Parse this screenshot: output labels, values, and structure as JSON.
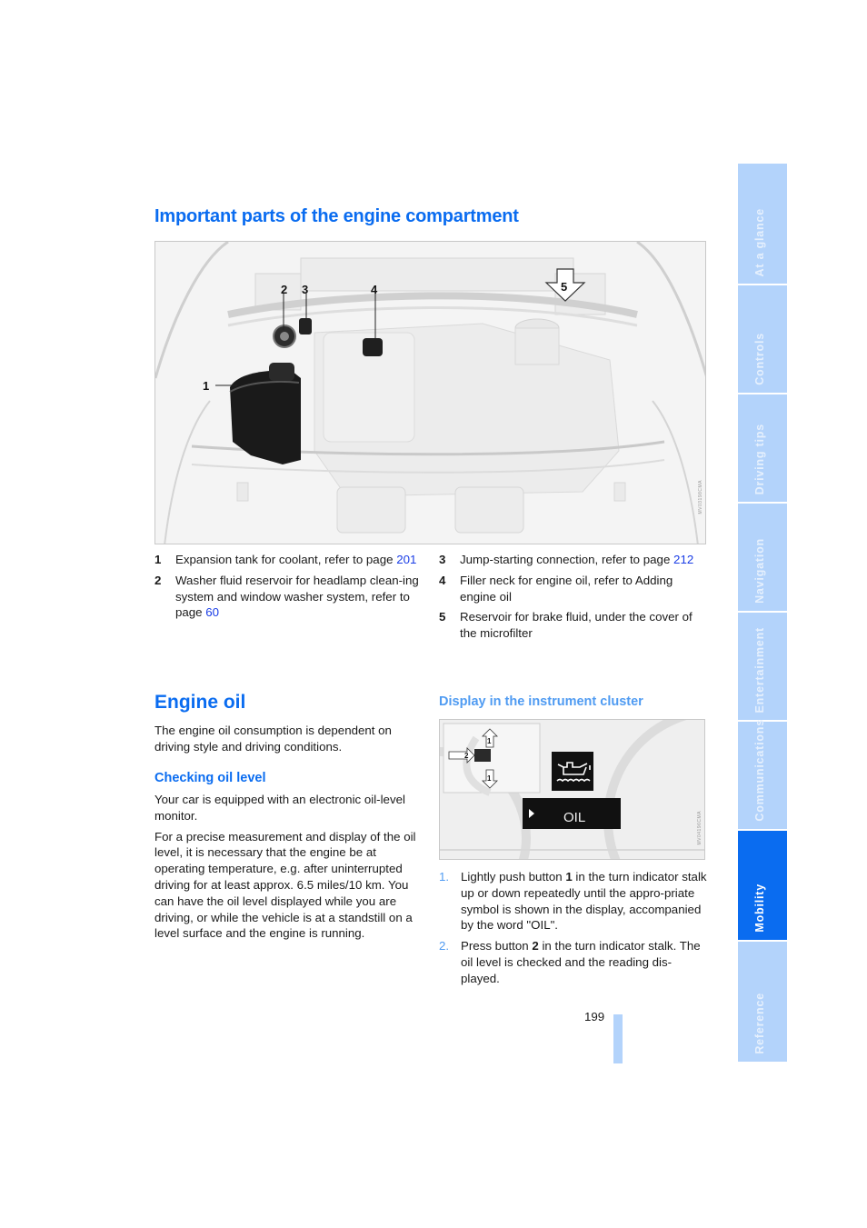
{
  "header": {
    "section_title": "Important parts of the engine compartment"
  },
  "engine_figure": {
    "callouts": [
      "1",
      "2",
      "3",
      "4",
      "5"
    ],
    "image_code": "MV03198CMA"
  },
  "legend": {
    "left": [
      {
        "num": "1",
        "text": "Expansion tank for coolant, refer to page ",
        "link": "201"
      },
      {
        "num": "2",
        "text": "Washer fluid reservoir for headlamp clean-ing system and window washer system, refer to page ",
        "link": "60"
      }
    ],
    "right": [
      {
        "num": "3",
        "text": "Jump-starting connection, refer to page ",
        "link": "212"
      },
      {
        "num": "4",
        "text": "Filler neck for engine oil, refer to Adding engine oil",
        "link": null
      },
      {
        "num": "5",
        "text": "Reservoir for brake fluid, under the cover of the microfilter",
        "link": null
      }
    ]
  },
  "engine_oil": {
    "title": "Engine oil",
    "intro": "The engine oil consumption is dependent on driving style and driving conditions.",
    "checking_title": "Checking oil level",
    "checking_p1": "Your car is equipped with an electronic oil-level monitor.",
    "checking_p2": "For a precise measurement and display of the oil level, it is necessary that the engine be at operating temperature, e.g. after uninterrupted driving for at least approx. 6.5 miles/10 km. You can have the oil level displayed while you are driving, or while the vehicle is at a standstill on a level surface and the engine is running."
  },
  "display": {
    "title": "Display in the instrument cluster",
    "screen_text": "OIL",
    "button_labels": [
      "1",
      "2",
      "1"
    ],
    "image_code": "MV04196CMA",
    "steps": [
      {
        "num": "1.",
        "pre": "Lightly push button ",
        "bold": "1",
        "post": " in the turn indicator stalk up or down repeatedly until the appro-priate symbol is shown in the display, accompanied by the word \"OIL\"."
      },
      {
        "num": "2.",
        "pre": "Press button ",
        "bold": "2",
        "post": " in the turn indicator stalk. The oil level is checked and the reading dis-played."
      }
    ]
  },
  "page": {
    "number": "199"
  },
  "side_tabs": [
    {
      "label": "At a glance",
      "active": false
    },
    {
      "label": "Controls",
      "active": false
    },
    {
      "label": "Driving tips",
      "active": false
    },
    {
      "label": "Navigation",
      "active": false
    },
    {
      "label": "Entertainment",
      "active": false
    },
    {
      "label": "Communications",
      "active": false
    },
    {
      "label": "Mobility",
      "active": true
    },
    {
      "label": "Reference",
      "active": false
    }
  ],
  "colors": {
    "heading_blue": "#0a6cf0",
    "subheading_light_blue": "#4f9bf2",
    "link_blue": "#1a3de6",
    "tab_inactive": "#b3d3fb",
    "tab_active": "#0a6cf0"
  }
}
